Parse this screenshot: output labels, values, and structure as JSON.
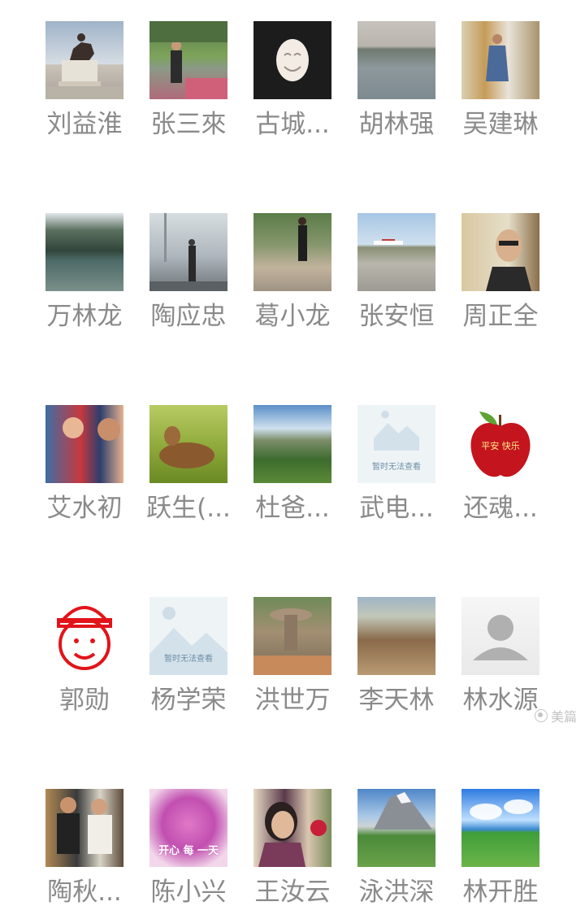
{
  "contacts": [
    {
      "name": "刘益淮",
      "thumb": "statue"
    },
    {
      "name": "张三來",
      "thumb": "garden"
    },
    {
      "name": "古城...",
      "thumb": "buddha"
    },
    {
      "name": "胡林强",
      "thumb": "lake"
    },
    {
      "name": "吴建琳",
      "thumb": "mall"
    },
    {
      "name": "万林龙",
      "thumb": "gorge"
    },
    {
      "name": "陶应忠",
      "thumb": "bridge"
    },
    {
      "name": "葛小龙",
      "thumb": "steps"
    },
    {
      "name": "张安恒",
      "thumb": "airport"
    },
    {
      "name": "周正全",
      "thumb": "portrait"
    },
    {
      "name": "艾水初",
      "thumb": "child"
    },
    {
      "name": "跃生(...",
      "thumb": "animal"
    },
    {
      "name": "杜爸...",
      "thumb": "valley"
    },
    {
      "name": "武电...",
      "thumb": "placeholder",
      "thumb_text": "暂时无法查看"
    },
    {
      "name": "还魂...",
      "thumb": "apple",
      "thumb_text": "平安  快乐"
    },
    {
      "name": "郭勋",
      "thumb": "cartoon"
    },
    {
      "name": "杨学荣",
      "thumb": "placeholder",
      "thumb_text": "暂时无法查看"
    },
    {
      "name": "洪世万",
      "thumb": "fountain"
    },
    {
      "name": "李天林",
      "thumb": "ruins"
    },
    {
      "name": "林水源",
      "thumb": "avatar"
    },
    {
      "name": "陶秋...",
      "thumb": "couple"
    },
    {
      "name": "陈小兴",
      "thumb": "flowers",
      "thumb_text": "开心 每 一天"
    },
    {
      "name": "王汝云",
      "thumb": "woman"
    },
    {
      "name": "泳洪深",
      "thumb": "alps"
    },
    {
      "name": "林开胜",
      "thumb": "meadow"
    }
  ],
  "watermark": {
    "label": "美篇"
  }
}
